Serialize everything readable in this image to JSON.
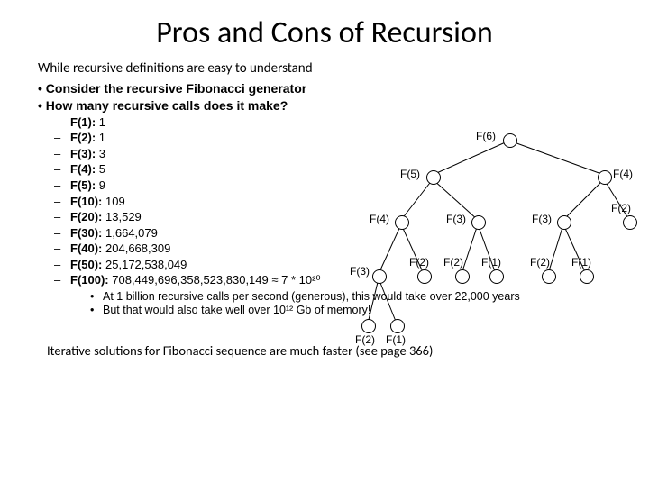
{
  "title": "Pros and Cons of Recursion",
  "subtitle": "While recursive definitions are easy to understand",
  "bullets": {
    "b1": "Consider the recursive Fibonacci generator",
    "b2": "How many recursive calls does it make?"
  },
  "calls": [
    {
      "fn": "F(1):",
      "val": "1"
    },
    {
      "fn": "F(2):",
      "val": "1"
    },
    {
      "fn": "F(3):",
      "val": "3"
    },
    {
      "fn": "F(4):",
      "val": "5"
    },
    {
      "fn": "F(5):",
      "val": "9"
    },
    {
      "fn": "F(10):",
      "val": "109"
    },
    {
      "fn": "F(20):",
      "val": "13,529"
    },
    {
      "fn": "F(30):",
      "val": "1,664,079"
    },
    {
      "fn": "F(40):",
      "val": "204,668,309"
    },
    {
      "fn": "F(50):",
      "val": "25,172,538,049"
    },
    {
      "fn": "F(100):",
      "val": "708,449,696,358,523,830,149 ≈ 7 * 10²⁰"
    }
  ],
  "notes": {
    "n1": "At 1 billion recursive calls per second (generous), this would take over 22,000 years",
    "n2": "But that would also take well over 10¹² Gb of memory!"
  },
  "footer": "Iterative solutions for Fibonacci sequence are much faster (see page 366)",
  "tree": {
    "labels": {
      "f6": "F(6)",
      "f5": "F(5)",
      "f4a": "F(4)",
      "f4b": "F(4)",
      "f3a": "F(3)",
      "f3b": "F(3)",
      "f3c": "F(3)",
      "f2a": "F(2)",
      "f2b": "F(2)",
      "f2c": "F(2)",
      "f2d": "F(2)",
      "f2e": "F(2)",
      "f1a": "F(1)",
      "f1b": "F(1)",
      "f1c": "F(1)"
    }
  }
}
